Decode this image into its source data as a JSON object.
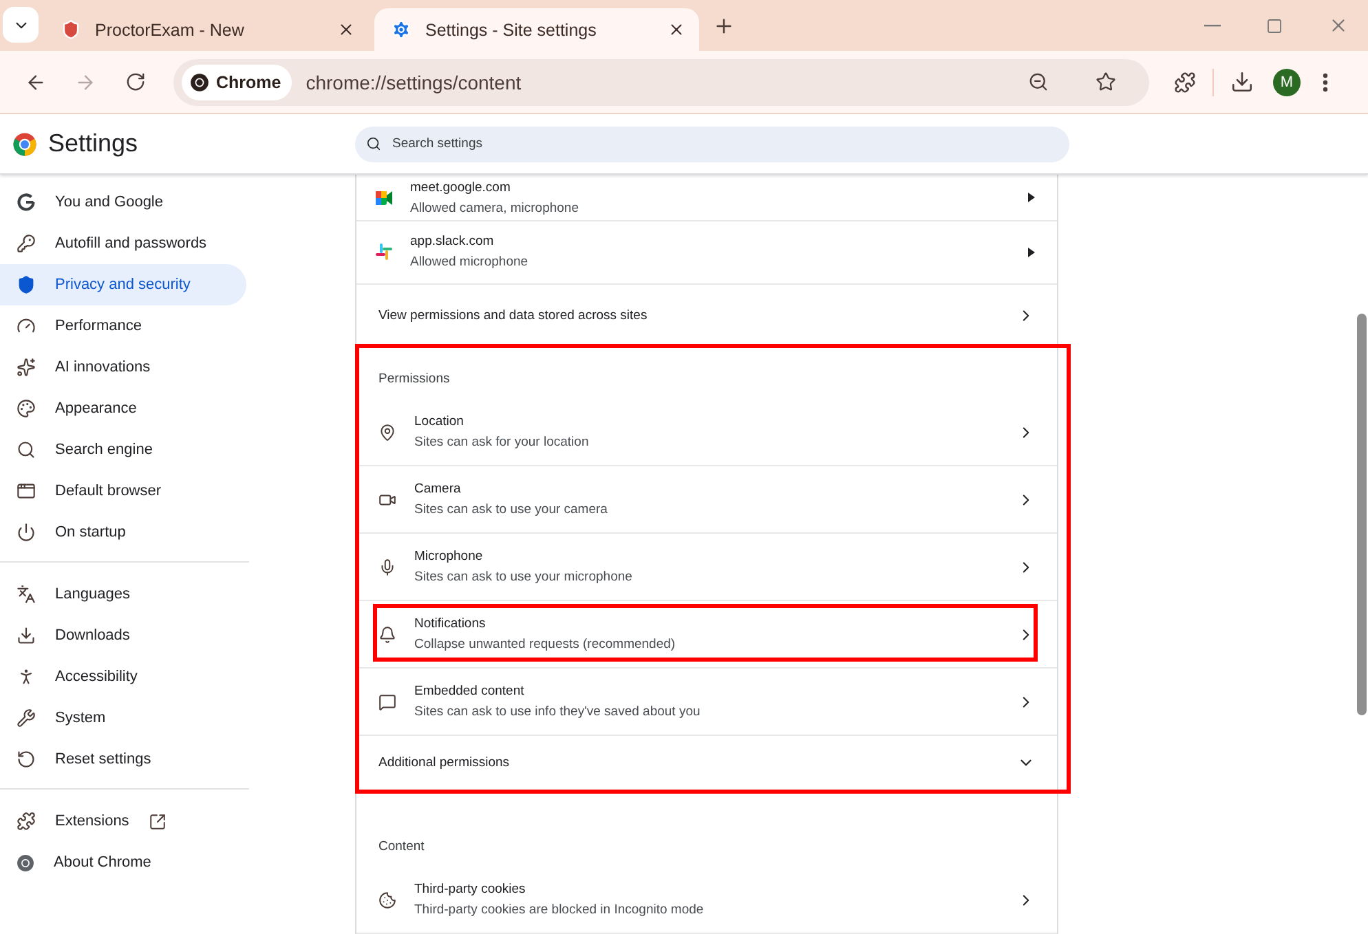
{
  "tabs": [
    {
      "title": "ProctorExam - New",
      "selected": false
    },
    {
      "title": "Settings - Site settings",
      "selected": true
    }
  ],
  "toolbar": {
    "chip": "Chrome",
    "url": "chrome://settings/content",
    "avatar": "M"
  },
  "header": {
    "title": "Settings",
    "search": {
      "placeholder": "Search settings"
    }
  },
  "sidebar": {
    "groups": [
      [
        {
          "label": "You and Google",
          "selected": false
        },
        {
          "label": "Autofill and passwords",
          "selected": false
        },
        {
          "label": "Privacy and security",
          "selected": true
        },
        {
          "label": "Performance",
          "selected": false
        },
        {
          "label": "AI innovations",
          "selected": false
        },
        {
          "label": "Appearance",
          "selected": false
        },
        {
          "label": "Search engine",
          "selected": false
        },
        {
          "label": "Default browser",
          "selected": false
        },
        {
          "label": "On startup",
          "selected": false
        }
      ],
      [
        {
          "label": "Languages",
          "selected": false
        },
        {
          "label": "Downloads",
          "selected": false
        },
        {
          "label": "Accessibility",
          "selected": false
        },
        {
          "label": "System",
          "selected": false
        },
        {
          "label": "Reset settings",
          "selected": false
        }
      ],
      [
        {
          "label": "Extensions",
          "selected": false,
          "external": true
        },
        {
          "label": "About Chrome",
          "selected": false,
          "external": false
        }
      ]
    ]
  },
  "sites": [
    {
      "site": "meet.google.com",
      "detail": "Allowed camera, microphone"
    },
    {
      "site": "app.slack.com",
      "detail": "Allowed microphone"
    }
  ],
  "view_all": "View permissions and data stored across sites",
  "sections": [
    {
      "title": "Permissions",
      "highlighted": true,
      "rows": [
        {
          "title": "Location",
          "detail": "Sites can ask for your location",
          "highlighted": false
        },
        {
          "title": "Camera",
          "detail": "Sites can ask to use your camera",
          "highlighted": false
        },
        {
          "title": "Microphone",
          "detail": "Sites can ask to use your microphone",
          "highlighted": false
        },
        {
          "title": "Notifications",
          "detail": "Collapse unwanted requests (recommended)",
          "highlighted": true
        },
        {
          "title": "Embedded content",
          "detail": "Sites can ask to use info they've saved about you",
          "highlighted": false
        }
      ],
      "more": {
        "label": "Additional permissions",
        "expanded": false
      }
    },
    {
      "title": "Content",
      "highlighted": false,
      "rows": [
        {
          "title": "Third-party cookies",
          "detail": "Third-party cookies are blocked in Incognito mode",
          "highlighted": false
        }
      ]
    }
  ]
}
